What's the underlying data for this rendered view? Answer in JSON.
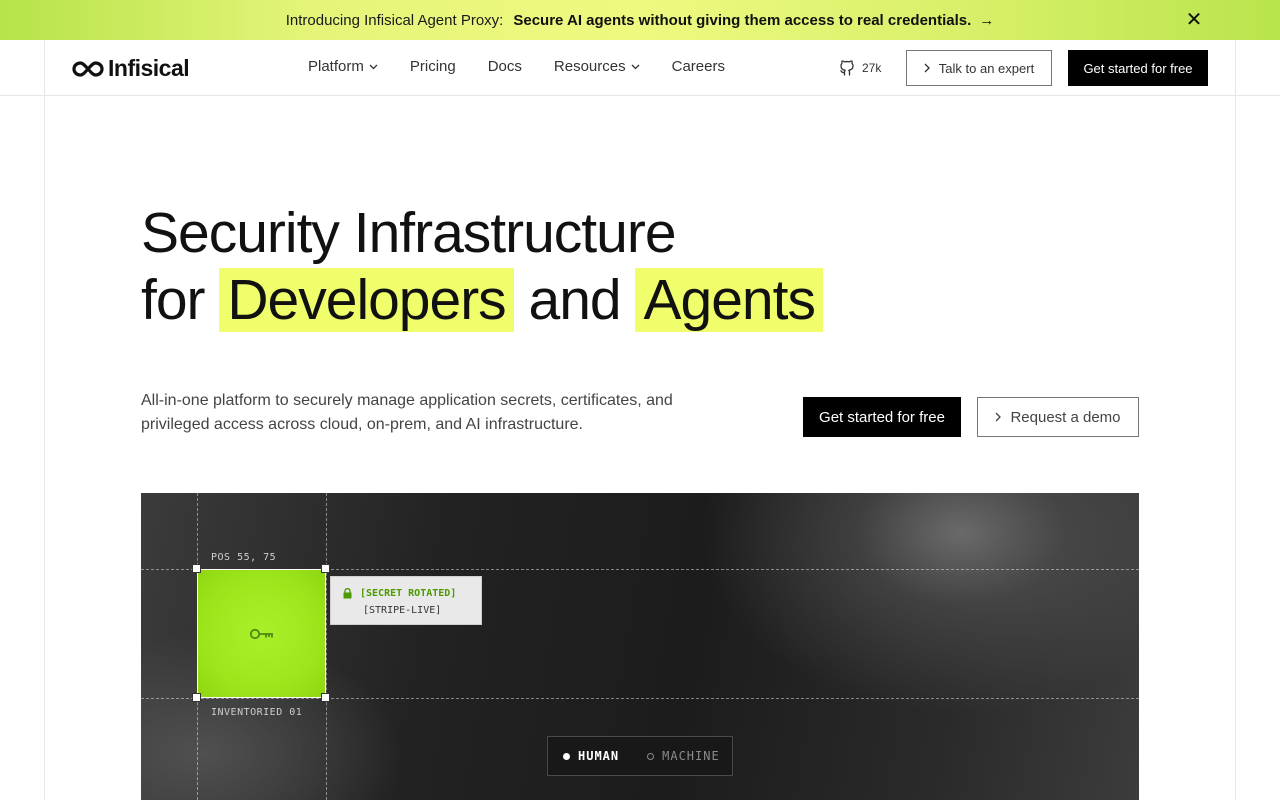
{
  "banner": {
    "intro": "Introducing Infisical Agent Proxy:",
    "headline": "Secure AI agents without giving them access to real credentials.",
    "arrow": "→",
    "close": "✕"
  },
  "nav": {
    "brand": "Infisical",
    "items": [
      {
        "label": "Platform",
        "dropdown": true
      },
      {
        "label": "Pricing",
        "dropdown": false
      },
      {
        "label": "Docs",
        "dropdown": false
      },
      {
        "label": "Resources",
        "dropdown": true
      },
      {
        "label": "Careers",
        "dropdown": false
      }
    ],
    "github_stars": "27k",
    "talk_label": "Talk to an expert",
    "cta_label": "Get started for free"
  },
  "hero": {
    "title_line1": "Security Infrastructure",
    "title_for": "for",
    "title_hl1": "Developers",
    "title_and": "and",
    "title_hl2": "Agents",
    "description": "All-in-one platform to securely manage application secrets, certificates, and privileged access across cloud, on-prem, and AI infrastructure.",
    "cta_primary": "Get started for free",
    "cta_secondary": "Request a demo"
  },
  "visual": {
    "pos_label": "POS 55, 75",
    "inventory_label": "INVENTORIED 01",
    "toast_line1": "[SECRET ROTATED]",
    "toast_line2": "[STRIPE-LIVE]",
    "toggle_human": "HUMAN",
    "toggle_machine": "MACHINE"
  },
  "colors": {
    "accent": "#f0fe6b",
    "green": "#9ee61c",
    "toast_green": "#4c9a00"
  },
  "icons": [
    "infinity-logo-icon",
    "github-icon",
    "chevron-down-icon",
    "chevron-right-icon",
    "key-icon",
    "lock-icon",
    "close-icon"
  ]
}
